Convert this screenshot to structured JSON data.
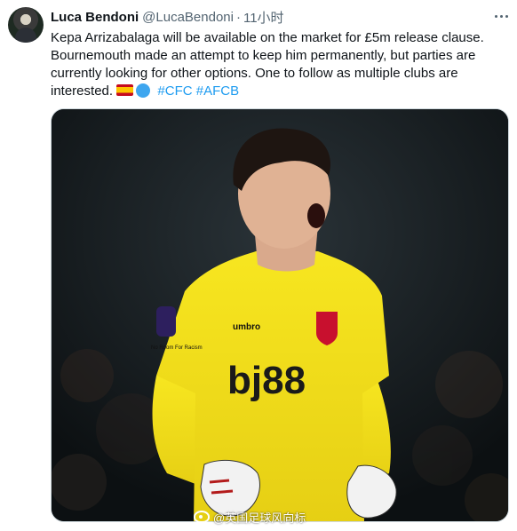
{
  "tweet": {
    "author_name": "Luca Bendoni",
    "handle": "@LucaBendoni",
    "separator": "·",
    "time": "11小时",
    "text_lines": [
      "Kepa Arrizabalaga will be available on the market for £5m release clause.",
      "Bournemouth made an attempt to keep him permanently, but parties are",
      "currently looking for other options. One to follow as multiple clubs are",
      "interested."
    ],
    "emoji": [
      "spain-flag",
      "blue-circle"
    ],
    "hashtags": [
      "#CFC",
      "#AFCB"
    ]
  },
  "media": {
    "sponsor_text": "bj88",
    "kit_brand_text": "umbro",
    "sleeve_patch_text": "No Room For Racism",
    "watermark_text": "@英国足球风向标"
  },
  "colors": {
    "hashtag": "#1d9bf0",
    "secondary_text": "#536471",
    "jersey_yellow": "#f6e21d",
    "background_dark": "#121719"
  }
}
